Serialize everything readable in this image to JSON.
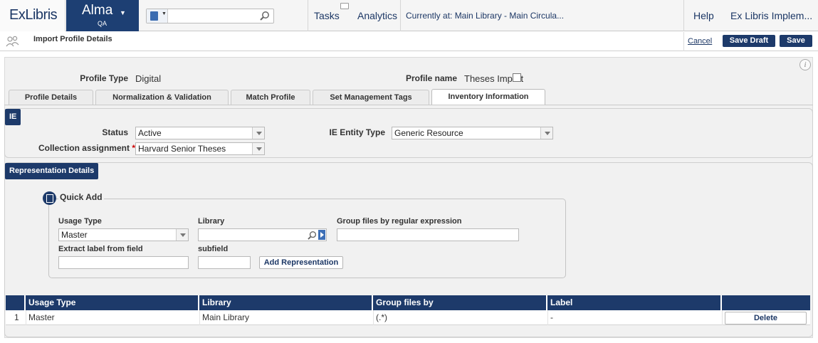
{
  "header": {
    "logo": "ExLibris",
    "app_name": "Alma",
    "environment": "QA",
    "search_placeholder": "",
    "nav_tasks": "Tasks",
    "nav_analytics": "Analytics",
    "location": "Currently at: Main Library - Main Circula...",
    "help": "Help",
    "user": "Ex Libris Implem..."
  },
  "subheader": {
    "title": "Import Profile Details",
    "cancel": "Cancel",
    "save_draft": "Save Draft",
    "save": "Save"
  },
  "profile": {
    "type_label": "Profile Type",
    "type_value": "Digital",
    "name_label": "Profile name",
    "name_value": "Theses Import"
  },
  "tabs": [
    {
      "label": "Profile Details",
      "active": false
    },
    {
      "label": "Normalization & Validation",
      "active": false
    },
    {
      "label": "Match Profile",
      "active": false
    },
    {
      "label": "Set Management Tags",
      "active": false
    },
    {
      "label": "Inventory Information",
      "active": true
    }
  ],
  "ie_section": {
    "header": "IE",
    "status_label": "Status",
    "status_value": "Active",
    "collection_label": "Collection assignment",
    "collection_value": "Harvard Senior Theses",
    "entity_label": "IE Entity Type",
    "entity_value": "Generic Resource"
  },
  "representation": {
    "header": "Representation Details",
    "quick_add_title": "Quick Add",
    "usage_type_label": "Usage Type",
    "usage_type_value": "Master",
    "library_label": "Library",
    "library_value": "",
    "group_label": "Group files by regular expression",
    "group_value": "",
    "extract_label": "Extract label from field",
    "extract_value": "",
    "subfield_label": "subfield",
    "subfield_value": "",
    "add_button": "Add Representation"
  },
  "table": {
    "columns": [
      "Usage Type",
      "Library",
      "Group files by",
      "Label"
    ],
    "rows": [
      {
        "index": "1",
        "usage_type": "Master",
        "library": "Main Library",
        "group_files_by": "(.*)",
        "label": "-",
        "action": "Delete"
      }
    ]
  },
  "colors": {
    "brand_navy": "#1d3a6a",
    "link_blue": "#1c3765",
    "required_red": "#cc0000"
  }
}
